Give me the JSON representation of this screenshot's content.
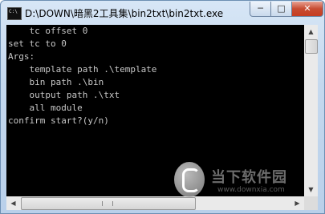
{
  "window": {
    "title": "D:\\DOWN\\暗黑2工具集\\bin2txt\\bin2txt.exe",
    "controls": {
      "minimize": "─",
      "maximize": "□",
      "close": "✕"
    }
  },
  "console": {
    "lines": [
      "    tc offset 0",
      "set tc to 0",
      "Args:",
      "    template path .\\template",
      "    bin path .\\bin",
      "    output path .\\txt",
      "    all module",
      "confirm start?(y/n)"
    ]
  },
  "watermark": {
    "text": "当下软件园",
    "url": "www.downxia.com"
  },
  "scrollbars": {
    "up": "▲",
    "down": "▼",
    "left": "◀",
    "right": "▶"
  }
}
